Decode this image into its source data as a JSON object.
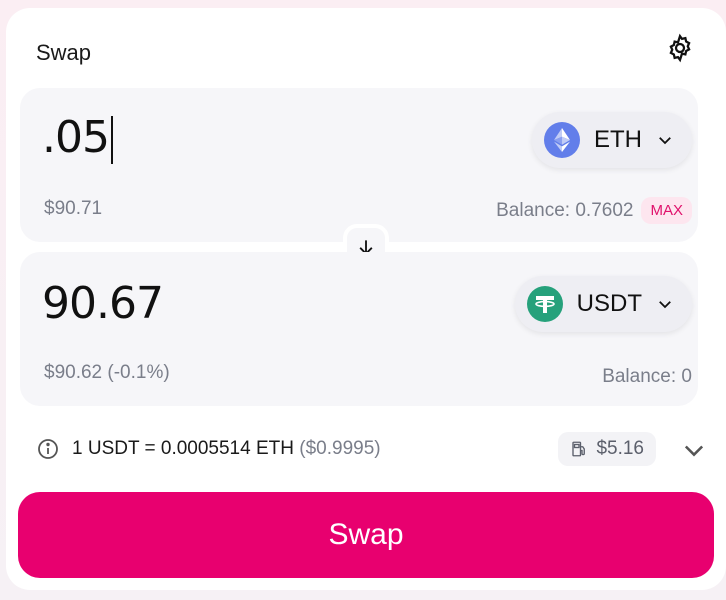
{
  "header": {
    "title": "Swap"
  },
  "sell": {
    "amount": ".05",
    "usd_value": "$90.71",
    "token": "ETH",
    "balance_label": "Balance: ",
    "balance_value": "0.7602",
    "max_label": "MAX"
  },
  "buy": {
    "amount": "90.67",
    "usd_value": "$90.62 (-0.1%)",
    "token": "USDT",
    "balance_label": "Balance: ",
    "balance_value": "0"
  },
  "rate": {
    "text": "1 USDT = 0.0005514 ETH",
    "usd": "($0.9995)"
  },
  "gas": {
    "value": "$5.16"
  },
  "swap_button": {
    "label": "Swap"
  },
  "colors": {
    "accent": "#e8006f",
    "eth": "#627eea",
    "usdt": "#26a17b"
  },
  "icons": [
    "gear-icon",
    "eth-icon",
    "chevron-down-icon",
    "arrow-down-icon",
    "usdt-icon",
    "info-icon",
    "gas-pump-icon"
  ]
}
